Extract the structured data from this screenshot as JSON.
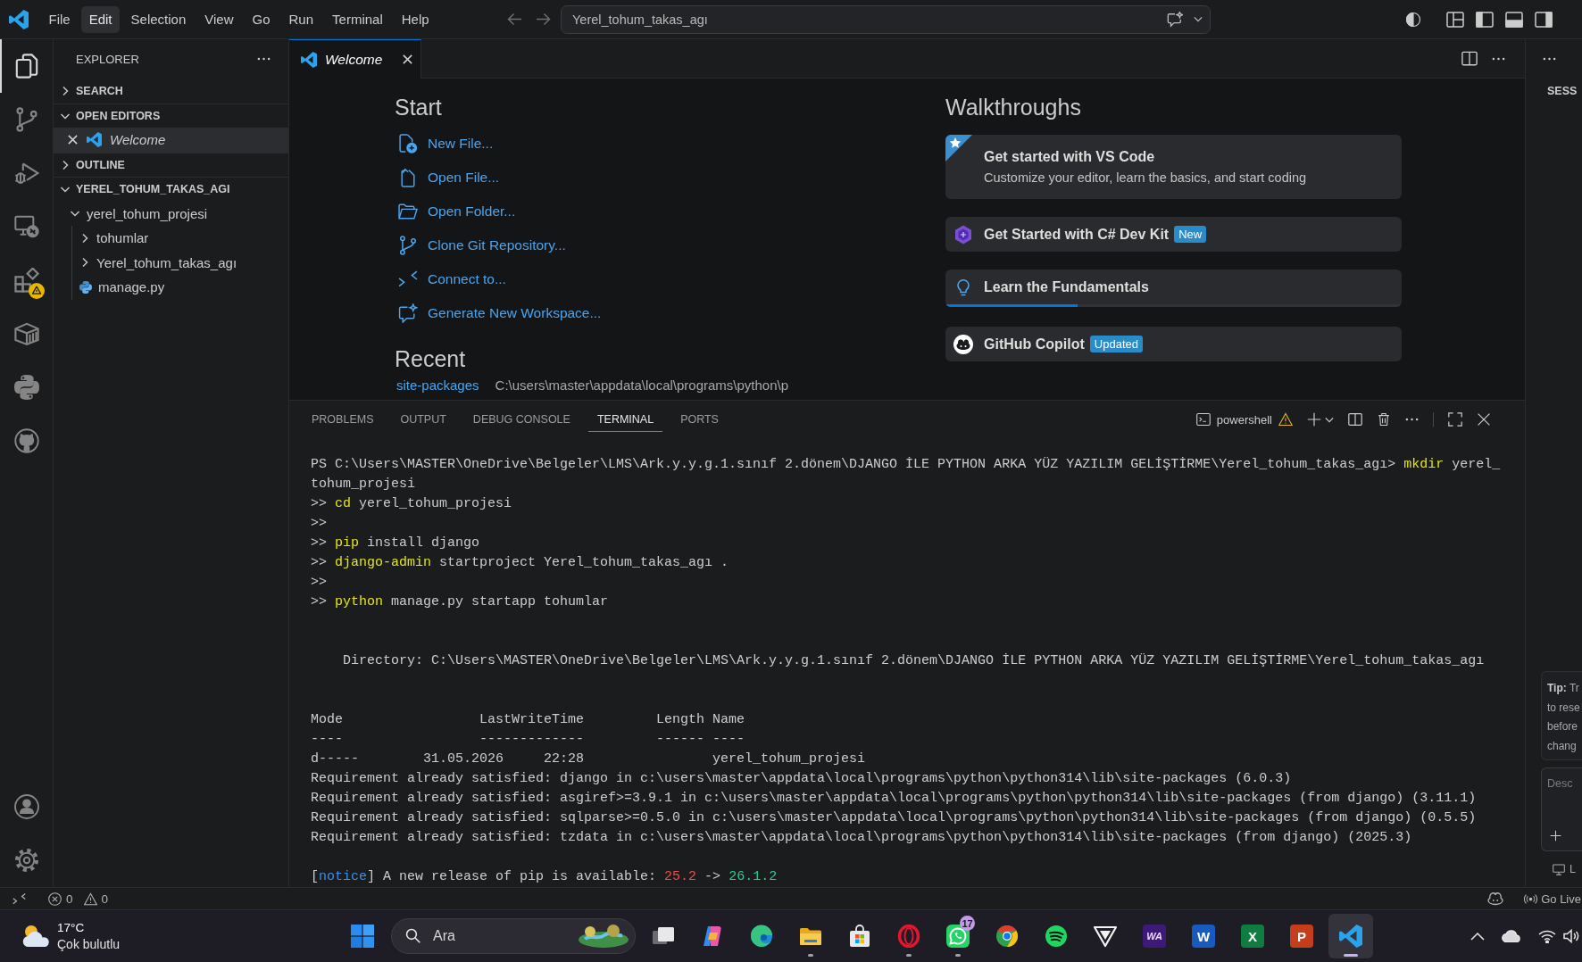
{
  "title_bar": {
    "menu": [
      {
        "label": "File",
        "selected": false
      },
      {
        "label": "Edit",
        "selected": true
      },
      {
        "label": "Selection",
        "selected": false
      },
      {
        "label": "View",
        "selected": false
      },
      {
        "label": "Go",
        "selected": false
      },
      {
        "label": "Run",
        "selected": false
      },
      {
        "label": "Terminal",
        "selected": false
      },
      {
        "label": "Help",
        "selected": false
      }
    ],
    "command_center": "Yerel_tohum_takas_agı"
  },
  "activity_bar": {
    "items": [
      {
        "kind": "explorer",
        "selected": true,
        "warning": false
      },
      {
        "kind": "source_control",
        "selected": false,
        "warning": false
      },
      {
        "kind": "run_debug",
        "selected": false,
        "warning": false
      },
      {
        "kind": "remote_explorer",
        "selected": false,
        "warning": false
      },
      {
        "kind": "extensions",
        "selected": false,
        "warning": true
      },
      {
        "kind": "containers",
        "selected": false,
        "warning": false
      },
      {
        "kind": "python",
        "selected": false,
        "warning": false
      },
      {
        "kind": "github",
        "selected": false,
        "warning": false
      }
    ]
  },
  "sidebar": {
    "title": "EXPLORER",
    "sections": [
      {
        "title": "SEARCH",
        "expanded": false
      },
      {
        "title": "OPEN EDITORS",
        "expanded": true,
        "items": [
          {
            "label": "Welcome",
            "selected": true
          }
        ]
      },
      {
        "title": "OUTLINE",
        "expanded": false
      },
      {
        "title": "YEREL_TOHUM_TAKAS_AGI",
        "expanded": true,
        "tree": [
          {
            "label": "yerel_tohum_projesi",
            "kind": "folder",
            "expanded": true,
            "children": [
              {
                "label": "tohumlar",
                "kind": "folder",
                "expanded": false
              },
              {
                "label": "Yerel_tohum_takas_agı",
                "kind": "folder",
                "expanded": false
              },
              {
                "label": "manage.py",
                "kind": "python_file"
              }
            ]
          }
        ]
      }
    ]
  },
  "editor": {
    "tabs": [
      {
        "label": "Welcome",
        "selected": true
      }
    ],
    "welcome": {
      "start": {
        "title": "Start",
        "actions": [
          {
            "kind": "new_file",
            "label": "New File..."
          },
          {
            "kind": "open_file",
            "label": "Open File..."
          },
          {
            "kind": "open_folder",
            "label": "Open Folder..."
          },
          {
            "kind": "clone",
            "label": "Clone Git Repository..."
          },
          {
            "kind": "connect",
            "label": "Connect to..."
          },
          {
            "kind": "generate",
            "label": "Generate New Workspace..."
          }
        ]
      },
      "recent": {
        "title": "Recent",
        "items": [
          {
            "name": "site-packages",
            "path": "C:\\users\\master\\appdata\\local\\programs\\python\\p"
          }
        ]
      },
      "walkthroughs": {
        "title": "Walkthroughs",
        "items": [
          {
            "kind": "featured",
            "title": "Get started with VS Code",
            "description": "Customize your editor, learn the basics, and start coding"
          },
          {
            "kind": "csharp",
            "title": "Get Started with C# Dev Kit",
            "badge": "New"
          },
          {
            "kind": "fundamentals",
            "title": "Learn the Fundamentals",
            "level": 0.29
          },
          {
            "kind": "copilot",
            "title": "GitHub Copilot",
            "badge": "Updated"
          }
        ]
      }
    }
  },
  "panel": {
    "tabs": [
      {
        "label": "PROBLEMS",
        "selected": false
      },
      {
        "label": "OUTPUT",
        "selected": false
      },
      {
        "label": "DEBUG CONSOLE",
        "selected": false
      },
      {
        "label": "TERMINAL",
        "selected": true
      },
      {
        "label": "PORTS",
        "selected": false
      }
    ],
    "terminal": {
      "name": "powershell",
      "warning": true,
      "lines": [
        {
          "kind": "text",
          "segments": [
            {
              "kind": "plain",
              "text": "PS C:\\Users\\MASTER\\OneDrive\\Belgeler\\LMS\\Ark.y.y.g.1.sınıf 2.dönem\\DJANGO İLE PYTHON ARKA YÜZ YAZILIM GELİŞTİRME\\Yerel_tohum_takas_agı> "
            },
            {
              "kind": "command",
              "text": "mkdir"
            },
            {
              "kind": "plain",
              "text": " yerel_"
            }
          ]
        },
        {
          "kind": "text",
          "segments": [
            {
              "kind": "plain",
              "text": "tohum_projesi"
            }
          ]
        },
        {
          "kind": "text",
          "segments": [
            {
              "kind": "plain",
              "text": ">> "
            },
            {
              "kind": "command",
              "text": "cd"
            },
            {
              "kind": "plain",
              "text": " yerel_tohum_projesi"
            }
          ]
        },
        {
          "kind": "text",
          "segments": [
            {
              "kind": "plain",
              "text": ">>"
            }
          ]
        },
        {
          "kind": "text",
          "segments": [
            {
              "kind": "plain",
              "text": ">> "
            },
            {
              "kind": "command",
              "text": "pip"
            },
            {
              "kind": "plain",
              "text": " install django"
            }
          ]
        },
        {
          "kind": "text",
          "segments": [
            {
              "kind": "plain",
              "text": ">> "
            },
            {
              "kind": "command",
              "text": "django-admin"
            },
            {
              "kind": "plain",
              "text": " startproject Yerel_tohum_takas_agı ."
            }
          ]
        },
        {
          "kind": "text",
          "segments": [
            {
              "kind": "plain",
              "text": ">>"
            }
          ]
        },
        {
          "kind": "text",
          "segments": [
            {
              "kind": "plain",
              "text": ">> "
            },
            {
              "kind": "command",
              "text": "python"
            },
            {
              "kind": "plain",
              "text": " manage.py startapp tohumlar"
            }
          ]
        },
        {
          "kind": "blank"
        },
        {
          "kind": "blank"
        },
        {
          "kind": "text",
          "segments": [
            {
              "kind": "plain",
              "text": "    Directory: C:\\Users\\MASTER\\OneDrive\\Belgeler\\LMS\\Ark.y.y.g.1.sınıf 2.dönem\\DJANGO İLE PYTHON ARKA YÜZ YAZILIM GELİŞTİRME\\Yerel_tohum_takas_agı"
            }
          ]
        },
        {
          "kind": "blank"
        },
        {
          "kind": "blank"
        },
        {
          "kind": "text",
          "segments": [
            {
              "kind": "plain",
              "text": "Mode                 LastWriteTime         Length Name"
            }
          ]
        },
        {
          "kind": "text",
          "segments": [
            {
              "kind": "plain",
              "text": "----                 -------------         ------ ----"
            }
          ]
        },
        {
          "kind": "text",
          "segments": [
            {
              "kind": "plain",
              "text": "d-----        31.05.2026     22:28                yerel_tohum_projesi"
            }
          ]
        },
        {
          "kind": "text",
          "segments": [
            {
              "kind": "plain",
              "text": "Requirement already satisfied: django in c:\\users\\master\\appdata\\local\\programs\\python\\python314\\lib\\site-packages (6.0.3)"
            }
          ]
        },
        {
          "kind": "text",
          "segments": [
            {
              "kind": "plain",
              "text": "Requirement already satisfied: asgiref>=3.9.1 in c:\\users\\master\\appdata\\local\\programs\\python\\python314\\lib\\site-packages (from django) (3.11.1)"
            }
          ]
        },
        {
          "kind": "text",
          "segments": [
            {
              "kind": "plain",
              "text": "Requirement already satisfied: sqlparse>=0.5.0 in c:\\users\\master\\appdata\\local\\programs\\python\\python314\\lib\\site-packages (from django) (0.5.5)"
            }
          ]
        },
        {
          "kind": "text",
          "segments": [
            {
              "kind": "plain",
              "text": "Requirement already satisfied: tzdata in c:\\users\\master\\appdata\\local\\programs\\python\\python314\\lib\\site-packages (from django) (2025.3)"
            }
          ]
        },
        {
          "kind": "blank"
        },
        {
          "kind": "text",
          "segments": [
            {
              "kind": "plain",
              "text": "["
            },
            {
              "kind": "notice",
              "text": "notice"
            },
            {
              "kind": "plain",
              "text": "] A new release of pip is available: "
            },
            {
              "kind": "old",
              "text": "25.2"
            },
            {
              "kind": "plain",
              "text": " -> "
            },
            {
              "kind": "new",
              "text": "26.1.2"
            }
          ]
        }
      ]
    }
  },
  "aux_bar": {
    "title": "SESS",
    "tip": [
      "**Tip:** Tr",
      "to rese",
      "before",
      "chang"
    ],
    "input": {
      "placeholder": "Desc"
    },
    "option": {
      "label": "L"
    }
  },
  "status_bar": {
    "errors": "0",
    "warnings": "0",
    "go_live": "Go Live"
  },
  "taskbar": {
    "weather": {
      "temperature": "17°C",
      "condition": "Çok bulutlu"
    },
    "search": {
      "placeholder": "Ara"
    },
    "apps": [
      {
        "kind": "task_view",
        "running": false,
        "selected": false
      },
      {
        "kind": "copilot",
        "running": false,
        "selected": false
      },
      {
        "kind": "edge",
        "running": false,
        "selected": false
      },
      {
        "kind": "file_explorer",
        "running": true,
        "selected": false
      },
      {
        "kind": "store",
        "running": false,
        "selected": false
      },
      {
        "kind": "opera",
        "running": true,
        "selected": false
      },
      {
        "kind": "whatsapp",
        "running": true,
        "selected": false,
        "badge": "17"
      },
      {
        "kind": "chrome",
        "running": false,
        "selected": false
      },
      {
        "kind": "spotify",
        "running": false,
        "selected": false
      },
      {
        "kind": "v_logo",
        "running": false,
        "selected": false
      },
      {
        "kind": "wa",
        "label": "WA",
        "running": false,
        "selected": false
      },
      {
        "kind": "word",
        "label": "W",
        "running": false,
        "selected": false
      },
      {
        "kind": "excel",
        "label": "X",
        "running": false,
        "selected": false
      },
      {
        "kind": "powerpoint",
        "label": "P",
        "running": false,
        "selected": false
      },
      {
        "kind": "vscode",
        "running": true,
        "selected": true
      }
    ]
  }
}
